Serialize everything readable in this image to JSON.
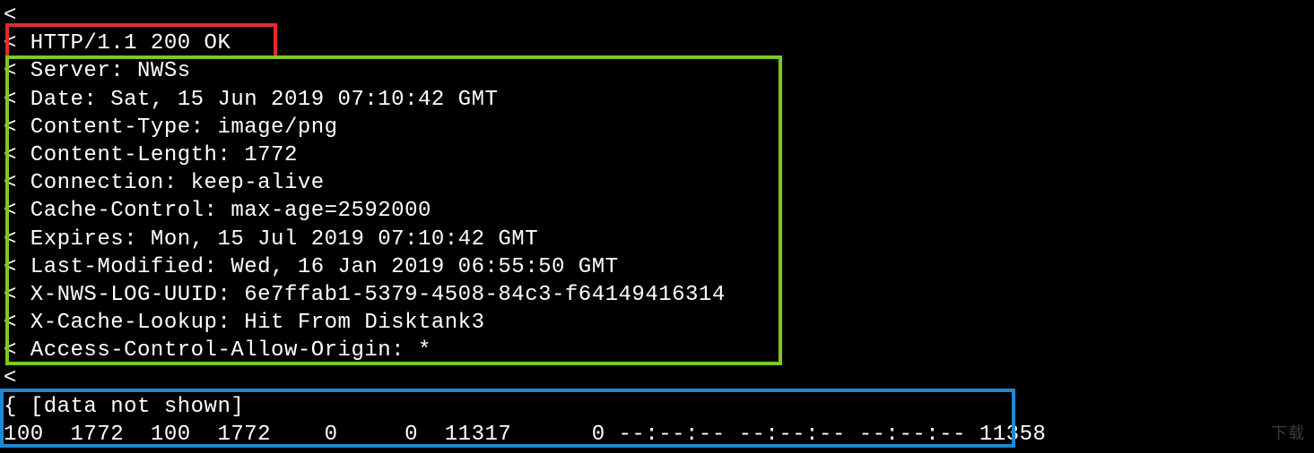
{
  "terminal": {
    "lines": [
      "< ",
      "< HTTP/1.1 200 OK",
      "< Server: NWSs",
      "< Date: Sat, 15 Jun 2019 07:10:42 GMT",
      "< Content-Type: image/png",
      "< Content-Length: 1772",
      "< Connection: keep-alive",
      "< Cache-Control: max-age=2592000",
      "< Expires: Mon, 15 Jul 2019 07:10:42 GMT",
      "< Last-Modified: Wed, 16 Jan 2019 06:55:50 GMT",
      "< X-NWS-LOG-UUID: 6e7ffab1-5379-4508-84c3-f64149416314",
      "< X-Cache-Lookup: Hit From Disktank3",
      "< Access-Control-Allow-Origin: *",
      "< ",
      "{ [data not shown]",
      "100  1772  100  1772    0     0  11317      0 --:--:-- --:--:-- --:--:-- 11358"
    ]
  },
  "highlights": {
    "red": "HTTP status line",
    "green": "Response headers block",
    "blue": "Transfer progress / body indicator"
  },
  "watermark": "下载"
}
